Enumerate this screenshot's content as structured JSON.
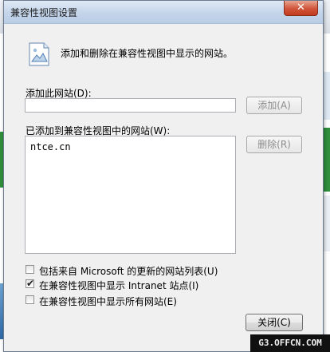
{
  "dialog": {
    "title": "兼容性视图设置",
    "close_glyph": "✕",
    "description": "添加和删除在兼容性视图中显示的网站。",
    "add_site_label": "添加此网站(D):",
    "add_site_value": "",
    "add_button": "添加(A)",
    "list_label": "已添加到兼容性视图中的网站(W):",
    "sites": [
      "ntce.cn"
    ],
    "remove_button": "删除(R)",
    "options": [
      {
        "label": "包括来自 Microsoft 的更新的网站列表(U)",
        "checked": false
      },
      {
        "label": "在兼容性视图中显示 Intranet 站点(I)",
        "checked": true
      },
      {
        "label": "在兼容性视图中显示所有网站(E)",
        "checked": false
      }
    ],
    "check_glyph": "✔",
    "close_button": "关闭(C)"
  },
  "watermark": "G3.OFFCN.COM"
}
